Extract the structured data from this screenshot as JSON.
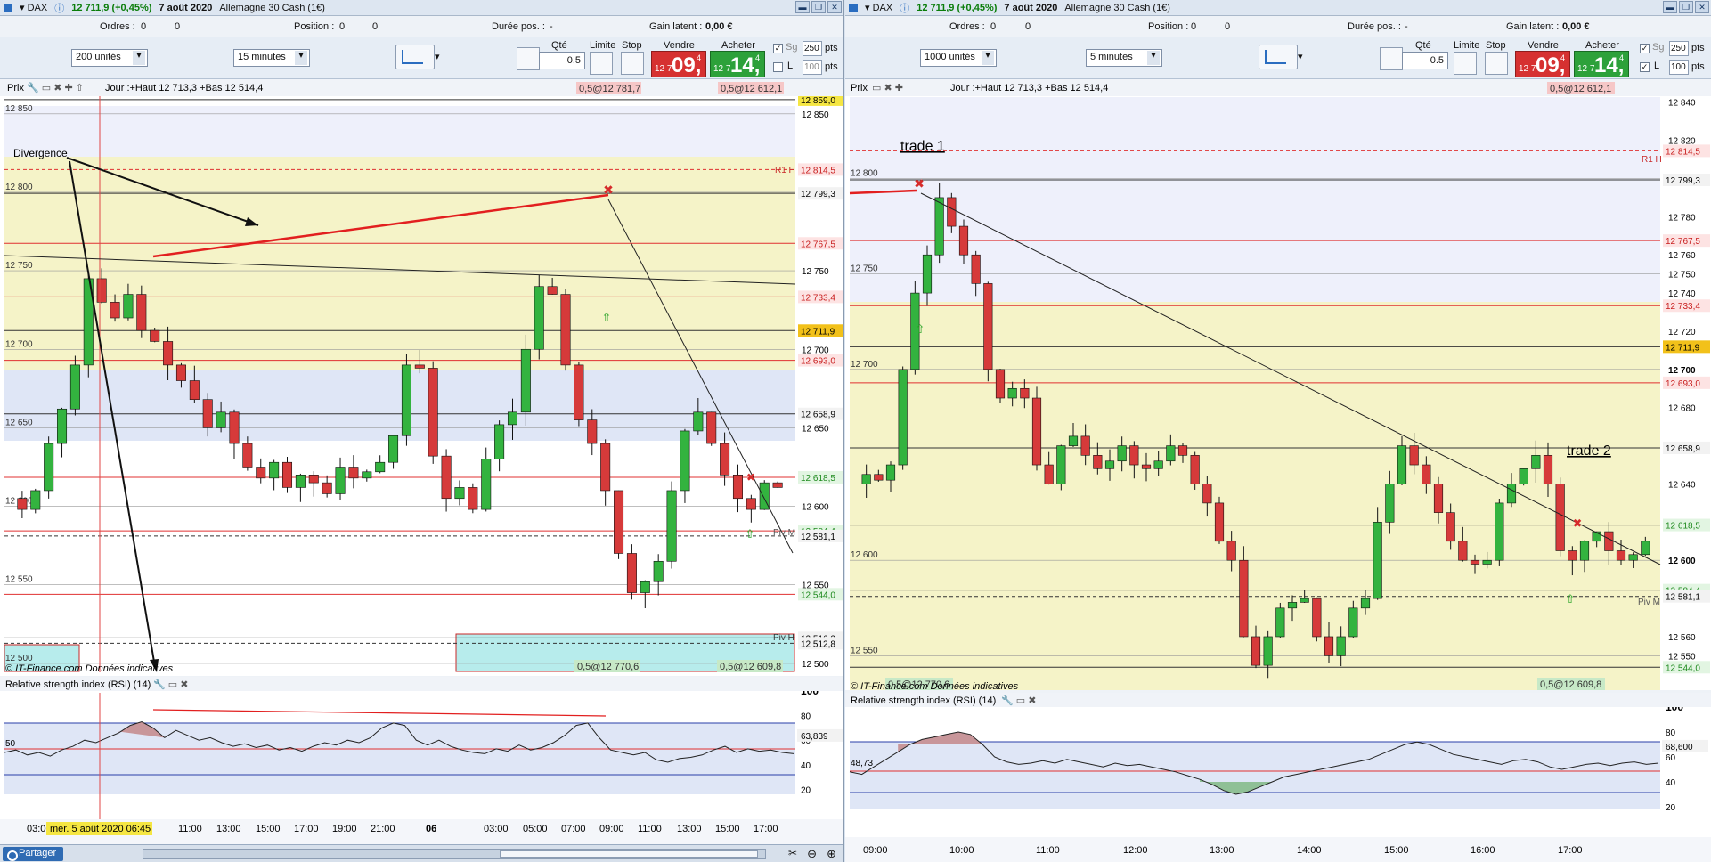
{
  "left": {
    "title": {
      "symbol": "DAX",
      "quote": "12 711,9 (+0,45%)",
      "date": "7 août 2020",
      "name": "Allemagne 30 Cash (1€)"
    },
    "info": {
      "ordres_label": "Ordres :",
      "ordres_v1": "0",
      "ordres_v2": "0",
      "position_label": "Position :",
      "position_v1": "0",
      "position_v2": "0",
      "duree_label": "Durée pos. :",
      "duree_value": "-",
      "gain_label": "Gain latent :",
      "gain_value": "0,00 €"
    },
    "toolbar": {
      "units": "200 unités",
      "timeframe": "15 minutes",
      "qte_label": "Qté",
      "qte": "0.5",
      "limite_label": "Limite",
      "stop_label": "Stop",
      "vendre_label": "Vendre",
      "acheter_label": "Acheter",
      "sell_small": "12 7",
      "sell_big": "09,",
      "sell_sup": "4",
      "buy_small": "12 7",
      "buy_big": "14,",
      "buy_sup": "4",
      "sg_label": "Sg",
      "l_label": "L",
      "pts1": "250",
      "pts2": "100",
      "pts_label": "pts"
    },
    "price_panel": {
      "title": "Prix",
      "info": "Jour :+Haut 12 713,3 +Bas 12 514,4",
      "badge_top1": "0,5@12 781,7",
      "badge_top2": "0,5@12 612,1",
      "badge_bot1": "0,5@12 770,6",
      "badge_bot2": "0,5@12 609,8",
      "watermark": "© IT-Finance.com  Données indicatives",
      "annotation": "Divergence",
      "r1_label": "R1 H",
      "piv_m": "Piv M",
      "piv_h": "Piv H"
    },
    "price_axis": [
      "12 850",
      "12 800",
      "12 750",
      "12 700",
      "12 650",
      "12 600",
      "12 550",
      "12 500"
    ],
    "price_tags": [
      {
        "text": "12 859,0",
        "bg": "#f5e642",
        "fg": "#000"
      },
      {
        "text": "12 814,5",
        "bg": "#fde3e3",
        "fg": "#c81e1e"
      },
      {
        "text": "12 799,3",
        "bg": "#f2f2f2",
        "fg": "#000"
      },
      {
        "text": "12 767,5",
        "bg": "#fde3e3",
        "fg": "#c81e1e"
      },
      {
        "text": "12 733,4",
        "bg": "#fde3e3",
        "fg": "#c81e1e"
      },
      {
        "text": "12 711,9",
        "bg": "#f2c11a",
        "fg": "#000"
      },
      {
        "text": "12 693,0",
        "bg": "#fde3e3",
        "fg": "#c81e1e"
      },
      {
        "text": "12 658,9",
        "bg": "#f2f2f2",
        "fg": "#000"
      },
      {
        "text": "12 618,5",
        "bg": "#e2f5e2",
        "fg": "#1f8a1f"
      },
      {
        "text": "12 584,4",
        "bg": "#e2f5e2",
        "fg": "#1f8a1f"
      },
      {
        "text": "12 581,1",
        "bg": "#f2f2f2",
        "fg": "#000"
      },
      {
        "text": "12 544,0",
        "bg": "#e2f5e2",
        "fg": "#1f8a1f"
      },
      {
        "text": "12 516,2",
        "bg": "#f2f2f2",
        "fg": "#000"
      },
      {
        "text": "12 512,8",
        "bg": "#f2f2f2",
        "fg": "#000"
      }
    ],
    "rsi": {
      "title": "Relative strength index (RSI) (14)",
      "axis": [
        "100",
        "80",
        "60",
        "40",
        "20"
      ],
      "tag": "63,839",
      "left_label": "50"
    },
    "time_axis": [
      "03:00",
      "11:00",
      "13:00",
      "15:00",
      "17:00",
      "19:00",
      "21:00",
      "06",
      "03:00",
      "05:00",
      "07:00",
      "09:00",
      "11:00",
      "13:00",
      "15:00",
      "17:00"
    ],
    "cursor_date": "mer. 5 août 2020 06:45",
    "share": "Partager"
  },
  "right": {
    "title": {
      "symbol": "DAX",
      "quote": "12 711,9 (+0,45%)",
      "date": "7 août 2020",
      "name": "Allemagne 30 Cash (1€)"
    },
    "info": {
      "ordres_label": "Ordres :",
      "ordres_v1": "0",
      "ordres_v2": "0",
      "position_label": "Position :",
      "position_v1": "0",
      "position_v2": "0",
      "duree_label": "Durée pos. :",
      "duree_value": "-",
      "gain_label": "Gain latent :",
      "gain_value": "0,00 €"
    },
    "toolbar": {
      "units": "1000 unités",
      "timeframe": "5 minutes",
      "qte_label": "Qté",
      "qte": "0.5",
      "limite_label": "Limite",
      "stop_label": "Stop",
      "vendre_label": "Vendre",
      "acheter_label": "Acheter",
      "sell_small": "12 7",
      "sell_big": "09,",
      "sell_sup": "4",
      "buy_small": "12 7",
      "buy_big": "14,",
      "buy_sup": "4",
      "sg_label": "Sg",
      "l_label": "L",
      "pts1": "250",
      "pts2": "100",
      "pts_label": "pts"
    },
    "price_panel": {
      "title": "Prix",
      "info": "Jour :+Haut 12 713,3 +Bas 12 514,4",
      "badge_top": "0,5@12 612,1",
      "badge_bot1": "0,5@12 770,6",
      "badge_bot2": "0,5@12 609,8",
      "watermark": "© IT-Finance.com  Données indicatives",
      "trade1": "trade 1",
      "trade2": "trade 2",
      "r1_label": "R1 H",
      "piv_m": "Piv M"
    },
    "price_axis": [
      "12 840",
      "12 820",
      "12 800",
      "12 780",
      "12 760",
      "12 750",
      "12 740",
      "12 720",
      "12 700",
      "12 680",
      "12 660",
      "12 640",
      "12 620",
      "12 600",
      "12 580",
      "12 560",
      "12 550"
    ],
    "price_tags": [
      {
        "text": "12 814,5",
        "bg": "#fde3e3",
        "fg": "#c81e1e"
      },
      {
        "text": "12 799,3",
        "bg": "#f2f2f2",
        "fg": "#000"
      },
      {
        "text": "12 767,5",
        "bg": "#fde3e3",
        "fg": "#c81e1e"
      },
      {
        "text": "12 733,4",
        "bg": "#fde3e3",
        "fg": "#c81e1e"
      },
      {
        "text": "12 711,9",
        "bg": "#f2c11a",
        "fg": "#000"
      },
      {
        "text": "12 693,0",
        "bg": "#fde3e3",
        "fg": "#c81e1e"
      },
      {
        "text": "12 658,9",
        "bg": "#f2f2f2",
        "fg": "#000"
      },
      {
        "text": "12 618,5",
        "bg": "#e2f5e2",
        "fg": "#1f8a1f"
      },
      {
        "text": "12 584,4",
        "bg": "#e2f5e2",
        "fg": "#1f8a1f"
      },
      {
        "text": "12 581,1",
        "bg": "#f2f2f2",
        "fg": "#000"
      },
      {
        "text": "12 544,0",
        "bg": "#e2f5e2",
        "fg": "#1f8a1f"
      }
    ],
    "rsi": {
      "title": "Relative strength index (RSI) (14)",
      "axis": [
        "100",
        "80",
        "60",
        "40",
        "20"
      ],
      "tag": "68,600",
      "left_label": "48,73"
    },
    "time_axis": [
      "09:00",
      "10:00",
      "11:00",
      "12:00",
      "13:00",
      "14:00",
      "15:00",
      "16:00",
      "17:00"
    ]
  }
}
